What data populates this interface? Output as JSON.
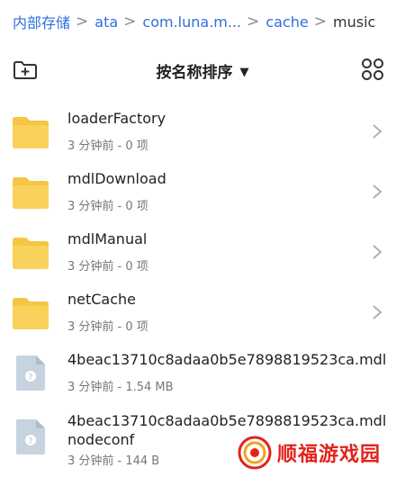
{
  "breadcrumb": {
    "items": [
      "内部存储",
      "ata",
      "com.luna.m...",
      "cache"
    ],
    "current": "music"
  },
  "toolbar": {
    "sort_label": "按名称排序",
    "sort_caret": "▼"
  },
  "files": [
    {
      "name": "loaderFactory",
      "meta": "3 分钟前 - 0 项",
      "type": "folder"
    },
    {
      "name": "mdlDownload",
      "meta": "3 分钟前 - 0 项",
      "type": "folder"
    },
    {
      "name": "mdlManual",
      "meta": "3 分钟前 - 0 项",
      "type": "folder"
    },
    {
      "name": "netCache",
      "meta": "3 分钟前 - 0 项",
      "type": "folder"
    },
    {
      "name": "4beac13710c8adaa0b5e7898819523ca.mdl",
      "meta": "3 分钟前 - 1.54 MB",
      "type": "file"
    },
    {
      "name": "4beac13710c8adaa0b5e7898819523ca.mdlnodeconf",
      "meta": "3 分钟前 - 144 B",
      "type": "file"
    }
  ],
  "watermark": {
    "text": "顺福游戏园"
  },
  "colors": {
    "accent": "#2f6fe0",
    "folder": "#f5c543",
    "file": "#c7d3de",
    "watermark": "#e2231a"
  }
}
